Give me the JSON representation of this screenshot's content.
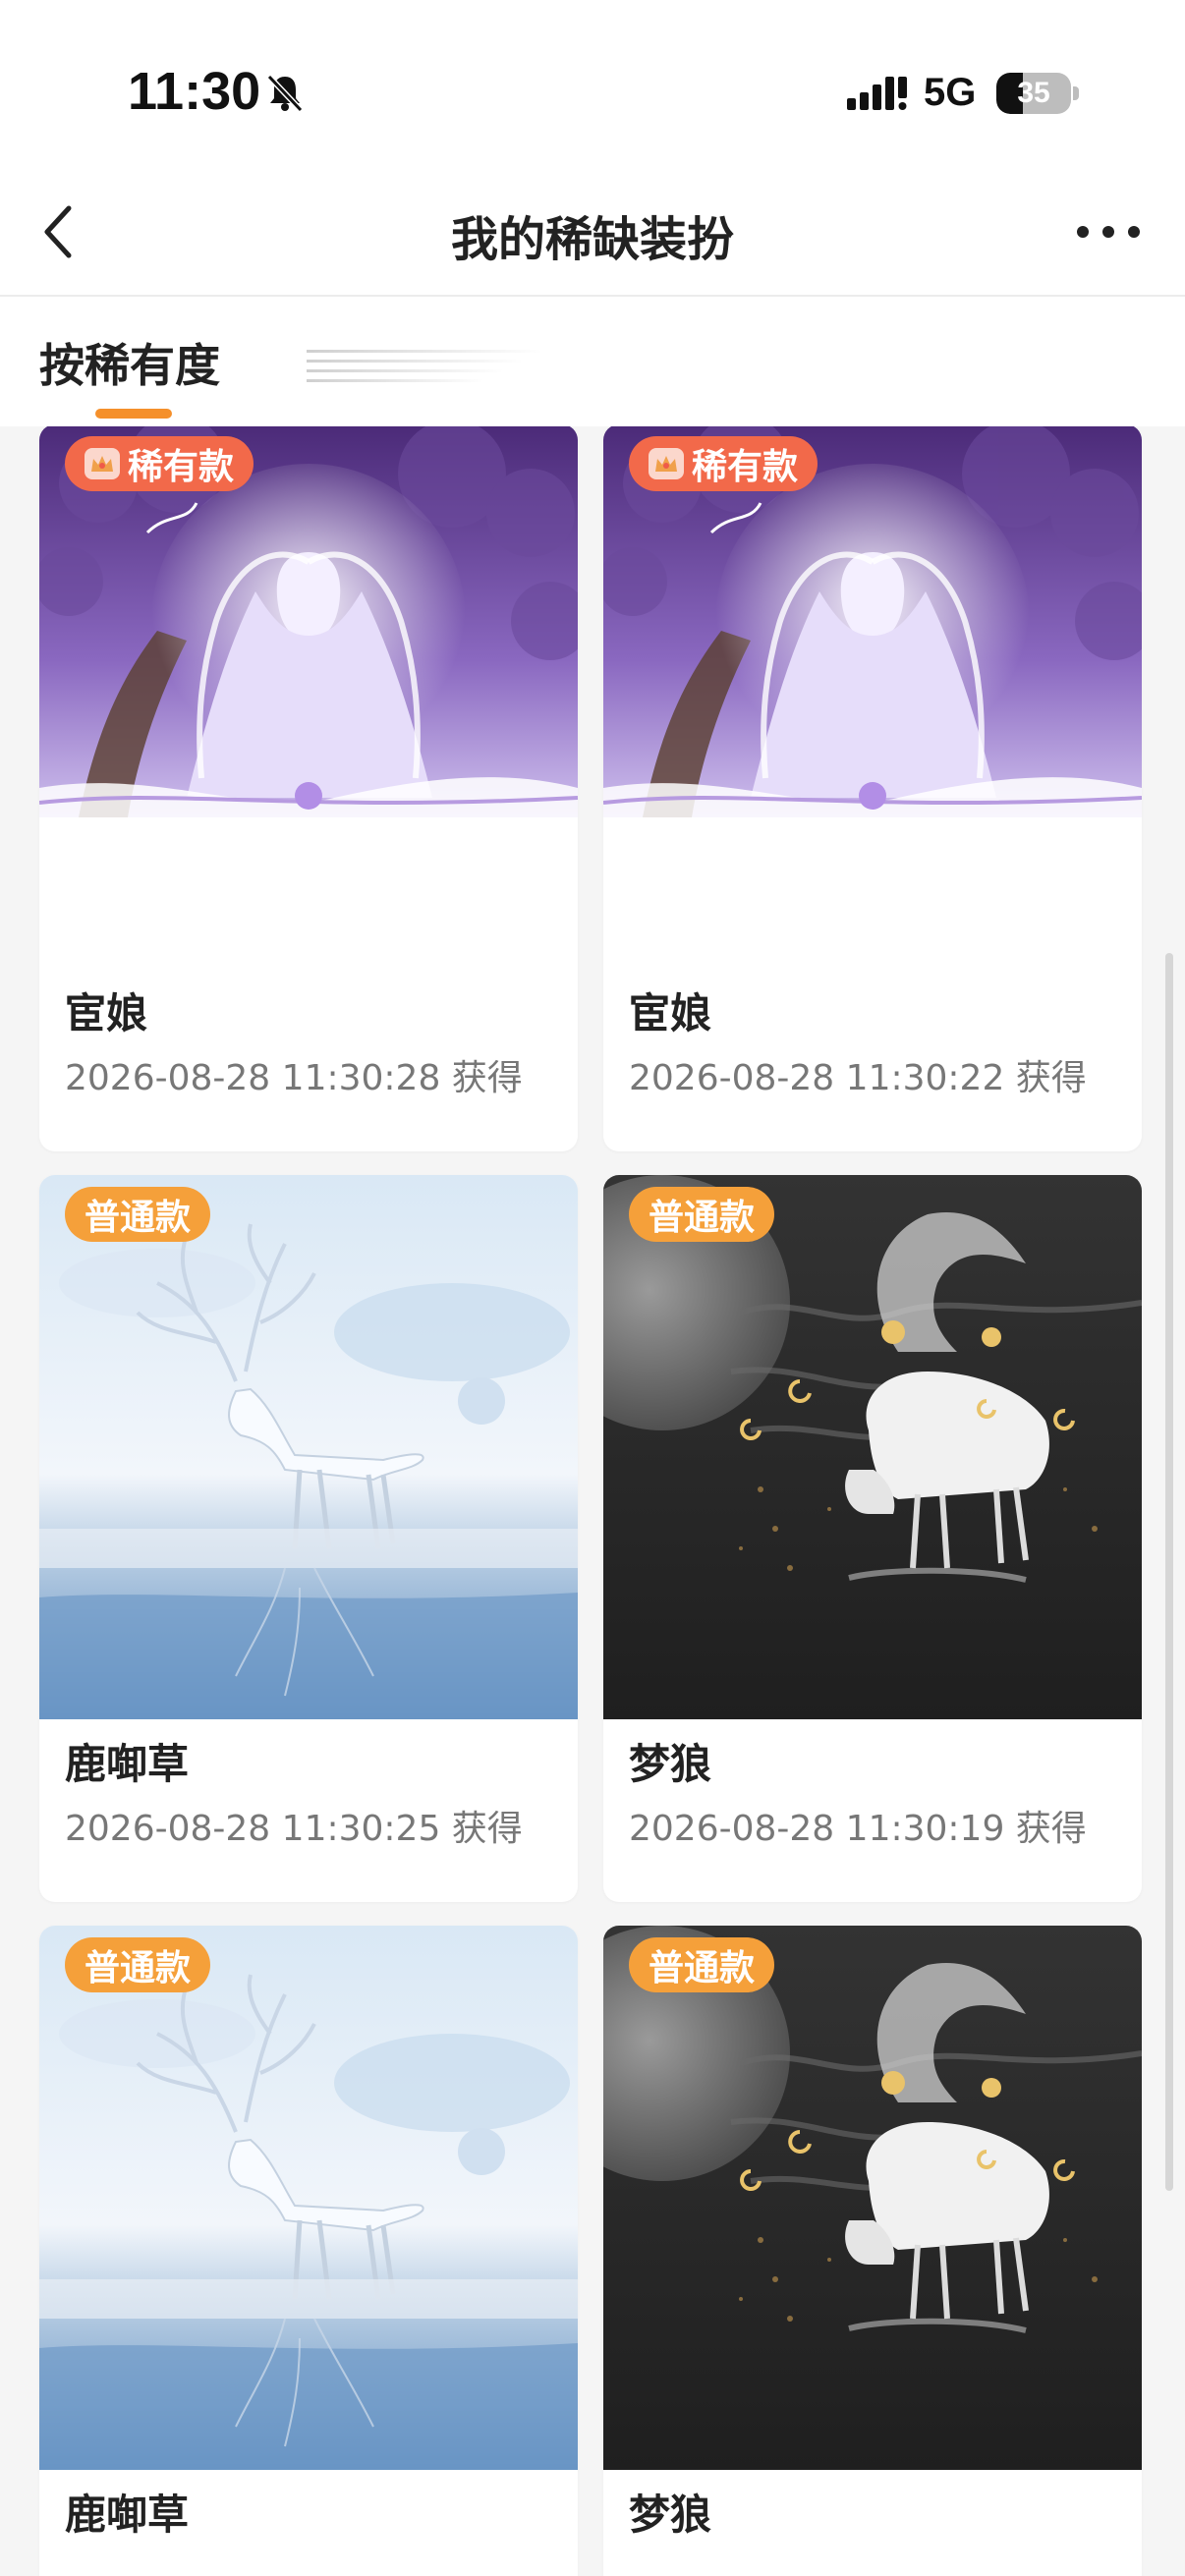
{
  "status_bar": {
    "time": "11:30",
    "network": "5G",
    "battery": "35",
    "battery_level": 0.35
  },
  "nav": {
    "title": "我的稀缺装扮"
  },
  "filter": {
    "sort_label": "按稀有度"
  },
  "colors": {
    "accent": "#f5902b",
    "rare_badge": "#f2694a",
    "common_badge": "#f5a03a"
  },
  "cards": [
    {
      "badge": "稀有款",
      "badge_type": "rare",
      "name": "宦娘",
      "time": "2026-08-28 11:30:28 获得",
      "art": "purple-maiden"
    },
    {
      "badge": "稀有款",
      "badge_type": "rare",
      "name": "宦娘",
      "time": "2026-08-28 11:30:22 获得",
      "art": "purple-maiden"
    },
    {
      "badge": "普通款",
      "badge_type": "common",
      "name": "鹿啣草",
      "time": "2026-08-28 11:30:25 获得",
      "art": "white-deer"
    },
    {
      "badge": "普通款",
      "badge_type": "common",
      "name": "梦狼",
      "time": "2026-08-28 11:30:19 获得",
      "art": "dream-wolf"
    },
    {
      "badge": "普通款",
      "badge_type": "common",
      "name": "鹿啣草",
      "time": "",
      "art": "white-deer"
    },
    {
      "badge": "普通款",
      "badge_type": "common",
      "name": "梦狼",
      "time": "",
      "art": "dream-wolf"
    }
  ]
}
